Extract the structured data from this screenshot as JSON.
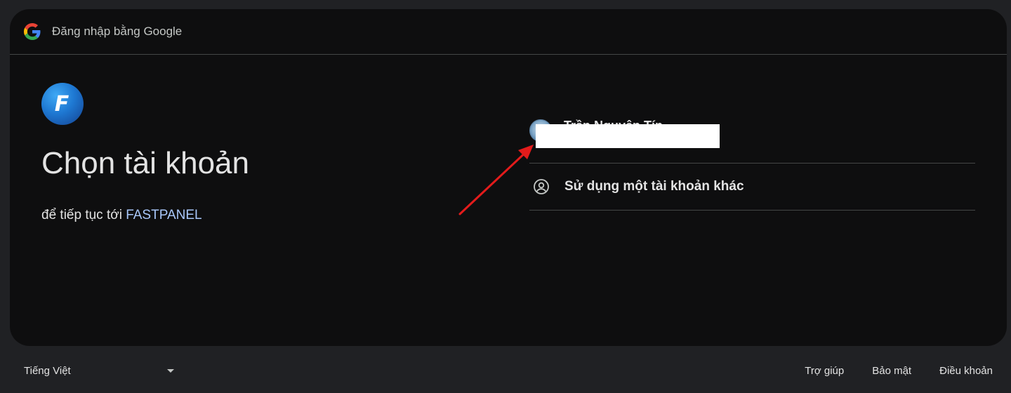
{
  "header": {
    "title": "Đăng nhập bằng Google",
    "logo_icon": "google-g-icon"
  },
  "app": {
    "logo_letter": "F",
    "logo_colors": [
      "#3fa9f5",
      "#1e78d2",
      "#14408f"
    ]
  },
  "main": {
    "title": "Chọn tài khoản",
    "subtitle_prefix": "để tiếp tục tới",
    "app_name": "FASTPANEL"
  },
  "accounts": [
    {
      "name": "Trần Nguyên Tín",
      "email": ""
    }
  ],
  "other_account": {
    "label": "Sử dụng một tài khoản khác",
    "icon": "person-circle-icon"
  },
  "footer": {
    "language": "Tiếng Việt",
    "links": [
      "Trợ giúp",
      "Bảo mật",
      "Điều khoản"
    ]
  },
  "colors": {
    "accent": "#a8c7fa",
    "background": "#202124",
    "card": "#0e0e0f",
    "annotation_arrow": "#e31b1b"
  }
}
